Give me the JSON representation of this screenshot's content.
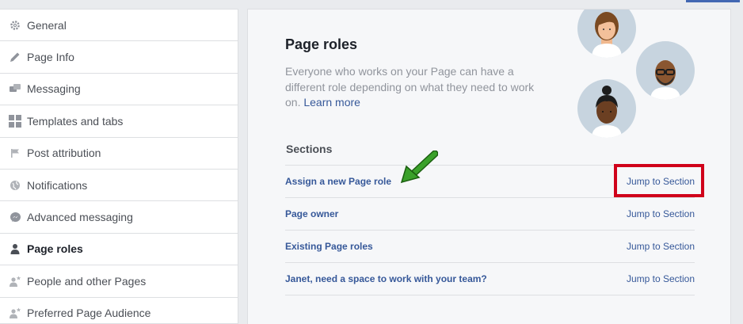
{
  "sidebar": {
    "items": [
      {
        "label": "General",
        "icon": "gear-icon"
      },
      {
        "label": "Page Info",
        "icon": "pencil-icon"
      },
      {
        "label": "Messaging",
        "icon": "chat-bubbles-icon"
      },
      {
        "label": "Templates and tabs",
        "icon": "grid-icon"
      },
      {
        "label": "Post attribution",
        "icon": "flag-icon"
      },
      {
        "label": "Notifications",
        "icon": "globe-icon"
      },
      {
        "label": "Advanced messaging",
        "icon": "messenger-icon"
      },
      {
        "label": "Page roles",
        "icon": "person-icon",
        "active": true
      },
      {
        "label": "People and other Pages",
        "icon": "person-star-icon"
      },
      {
        "label": "Preferred Page Audience",
        "icon": "person-star-icon"
      }
    ]
  },
  "main": {
    "title": "Page roles",
    "description": "Everyone who works on your Page can have a different role depending on what they need to work on.",
    "learn_more": "Learn more",
    "sections_heading": "Sections",
    "rows": [
      {
        "title": "Assign a new Page role",
        "jump": "Jump to Section"
      },
      {
        "title": "Page owner",
        "jump": "Jump to Section"
      },
      {
        "title": "Existing Page roles",
        "jump": "Jump to Section"
      },
      {
        "title": "Janet, need a space to work with your team?",
        "jump": "Jump to Section"
      }
    ]
  },
  "colors": {
    "link": "#365899",
    "highlight_box": "#d0021b",
    "arrow": "#2e8b1f",
    "avatar_bg": "#c7d4df"
  }
}
